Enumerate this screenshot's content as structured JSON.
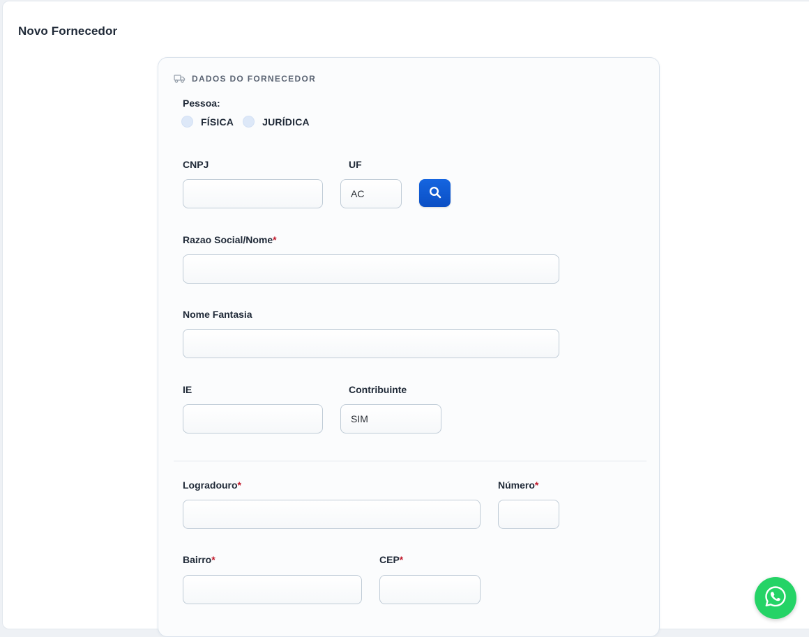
{
  "page": {
    "title": "Novo Fornecedor"
  },
  "section": {
    "title": "DADOS DO FORNECEDOR",
    "icon": "truck-icon"
  },
  "pessoa": {
    "label": "Pessoa:",
    "options": [
      "FÍSICA",
      "JURÍDICA"
    ]
  },
  "fields": {
    "cnpj": {
      "label": "CNPJ",
      "value": ""
    },
    "uf": {
      "label": "UF",
      "value": "AC"
    },
    "razao_social": {
      "label": "Razao Social/Nome",
      "required_mark": "*",
      "value": ""
    },
    "nome_fantasia": {
      "label": "Nome Fantasia",
      "value": ""
    },
    "ie": {
      "label": "IE",
      "value": ""
    },
    "contribuinte": {
      "label": "Contribuinte",
      "value": "SIM"
    },
    "logradouro": {
      "label": "Logradouro",
      "required_mark": "*",
      "value": ""
    },
    "numero": {
      "label": "Número",
      "required_mark": "*",
      "value": ""
    },
    "bairro": {
      "label": "Bairro",
      "required_mark": "*",
      "value": ""
    },
    "cep": {
      "label": "CEP",
      "required_mark": "*",
      "value": ""
    }
  },
  "buttons": {
    "search_icon": "search-icon",
    "whatsapp_icon": "whatsapp-icon"
  },
  "colors": {
    "primary": "#0b4fc4",
    "required": "#c0182a",
    "whatsapp": "#25d366",
    "radio": "#dde8f8"
  }
}
